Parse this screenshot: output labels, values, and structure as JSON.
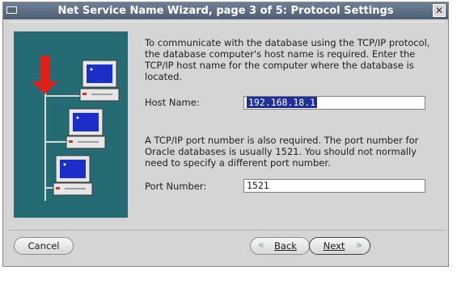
{
  "window": {
    "title": "Net Service Name Wizard, page 3 of 5: Protocol Settings"
  },
  "intro_text": "To communicate with the database using the TCP/IP protocol, the database computer's host name is required.  Enter the TCP/IP host name for the computer where the database is located.",
  "host": {
    "label": "Host Name:",
    "value": "192.168.18.1"
  },
  "port_text": "A TCP/IP port number is also required.  The port number for Oracle databases is usually 1521.  You should not normally need to specify a different port number.",
  "port": {
    "label": "Port Number:",
    "value": "1521"
  },
  "buttons": {
    "cancel": "Cancel",
    "back": "Back",
    "next": "Next"
  },
  "colors": {
    "titlebar": "#5f6e84",
    "illustration": "#246b73",
    "selection": "#1e2f9a",
    "arrow": "#e0201a"
  }
}
